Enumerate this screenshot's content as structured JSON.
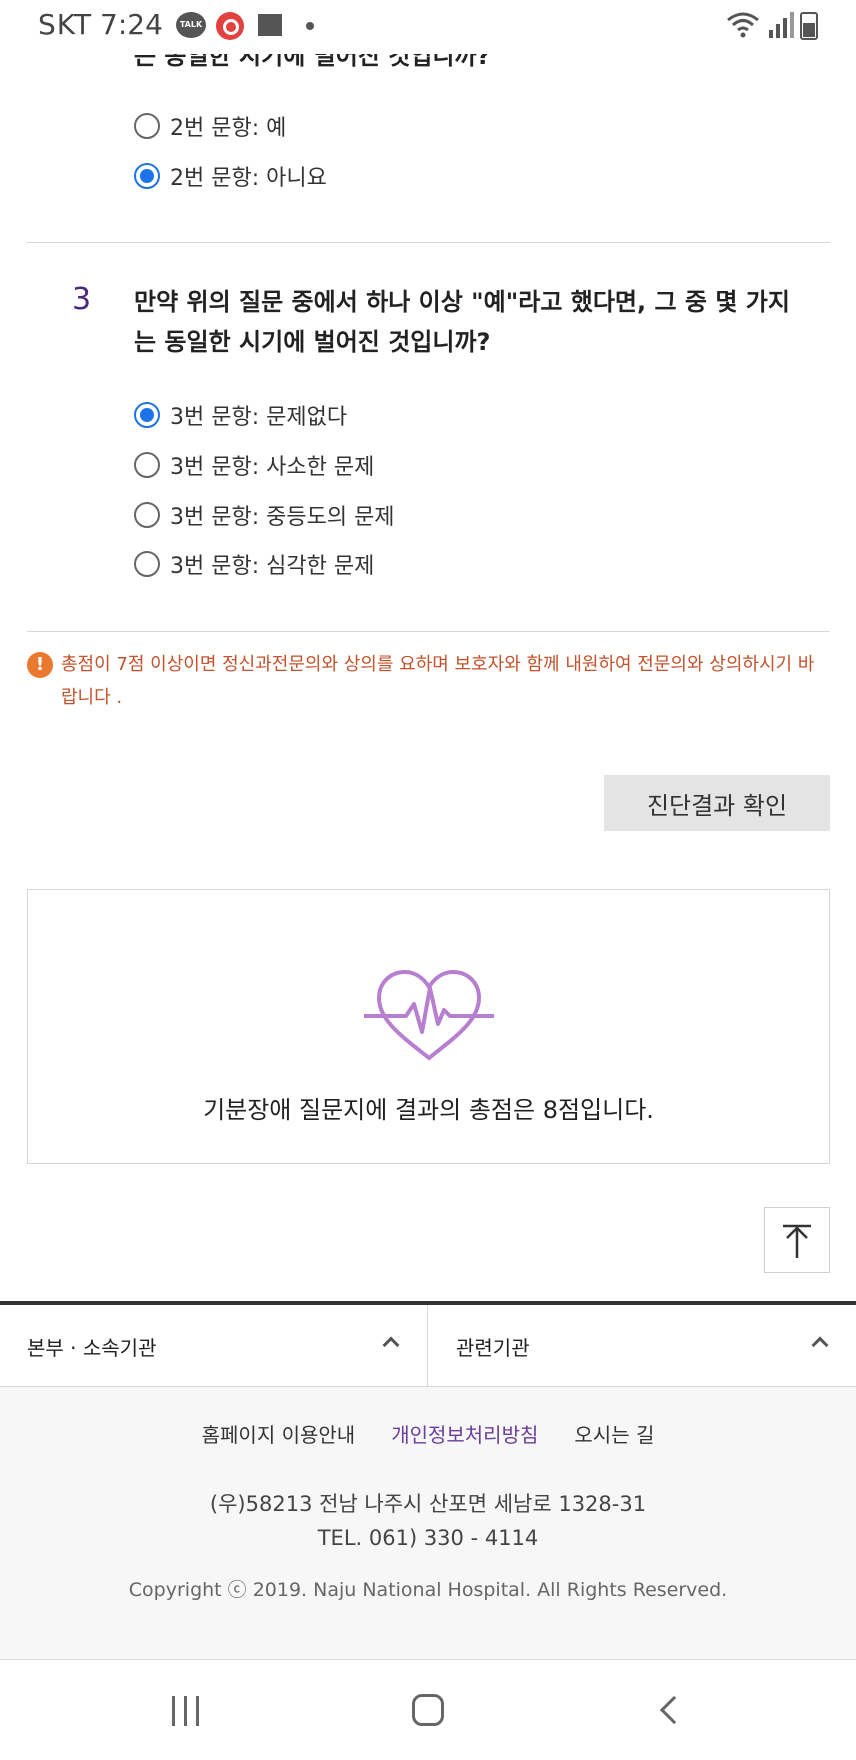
{
  "status_bar": {
    "carrier": "SKT",
    "time": "7:24",
    "talk_badge": "TALK"
  },
  "question2": {
    "text_cut": "는 동일한 시기에 벌어진 것입니까?",
    "options": [
      {
        "label": "2번 문항: 예",
        "checked": false
      },
      {
        "label": "2번 문항: 아니요",
        "checked": true
      }
    ]
  },
  "question3": {
    "number": "3",
    "text": "만약 위의 질문 중에서 하나 이상 \"예\"라고 했다면, 그 중 몇 가지는 동일한 시기에 벌어진 것입니까?",
    "options": [
      {
        "label": "3번 문항: 문제없다",
        "checked": true
      },
      {
        "label": "3번 문항: 사소한 문제",
        "checked": false
      },
      {
        "label": "3번 문항: 중등도의 문제",
        "checked": false
      },
      {
        "label": "3번 문항: 심각한 문제",
        "checked": false
      }
    ]
  },
  "notice": {
    "icon": "!",
    "text": "총점이 7점 이상이면 정신과전문의와 상의를 요하며 보호자와 함께 내원하여 전문의와 상의하시기 바랍니다 ."
  },
  "result_button": "진단결과 확인",
  "result": {
    "icon": "heart-pulse-icon",
    "text": "기분장애 질문지에 결과의 총점은 8점입니다."
  },
  "footer": {
    "tabs": [
      "본부 · 소속기관",
      "관련기관"
    ],
    "links": [
      "홈페이지 이용안내",
      "개인정보처리방침",
      "오시는 길"
    ],
    "address": "(우)58213 전남 나주시 산포면 세남로 1328-31",
    "tel": "TEL. 061) 330 - 4114",
    "copyright": "Copyright ⓒ 2019. Naju National Hospital. All Rights Reserved."
  },
  "colors": {
    "radio_checked": "#1c74e8",
    "notice": "#c4522b",
    "accent_purple": "#6a3f9a",
    "heart": "#b77fcf"
  }
}
